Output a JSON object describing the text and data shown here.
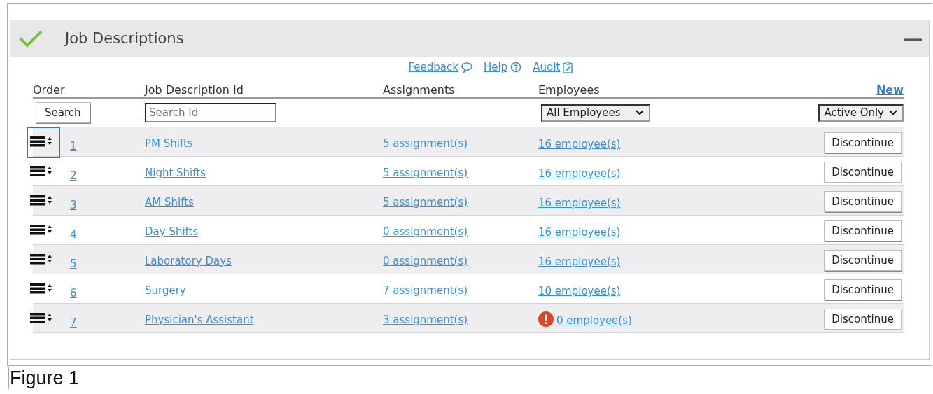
{
  "panel": {
    "title": "Job Descriptions",
    "collapse": "—"
  },
  "links": [
    {
      "label": "Feedback",
      "kind": "feedback"
    },
    {
      "label": "Help",
      "kind": "help"
    },
    {
      "label": "Audit",
      "kind": "audit"
    }
  ],
  "columns": [
    "Order",
    "Job Description Id",
    "Assignments",
    "Employees"
  ],
  "new_link": "New",
  "filters": {
    "search_button": "Search",
    "search_placeholder": "Search Id",
    "employees_select": "All Employees",
    "status_select": "Active Only"
  },
  "rows": [
    {
      "order": "1",
      "name": "PM Shifts",
      "assignments": "5 assignment(s)",
      "employees": "16 employee(s)",
      "warning": false,
      "focused": true,
      "action": "Discontinue"
    },
    {
      "order": "2",
      "name": "Night Shifts",
      "assignments": "5 assignment(s)",
      "employees": "16 employee(s)",
      "warning": false,
      "focused": false,
      "action": "Discontinue"
    },
    {
      "order": "3",
      "name": "AM Shifts",
      "assignments": "5 assignment(s)",
      "employees": "16 employee(s)",
      "warning": false,
      "focused": false,
      "action": "Discontinue"
    },
    {
      "order": "4",
      "name": "Day Shifts",
      "assignments": "0 assignment(s)",
      "employees": "16 employee(s)",
      "warning": false,
      "focused": false,
      "action": "Discontinue"
    },
    {
      "order": "5",
      "name": "Laboratory Days",
      "assignments": "0 assignment(s)",
      "employees": "16 employee(s)",
      "warning": false,
      "focused": false,
      "action": "Discontinue"
    },
    {
      "order": "6",
      "name": "Surgery",
      "assignments": "7 assignment(s)",
      "employees": "10 employee(s)",
      "warning": false,
      "focused": false,
      "action": "Discontinue"
    },
    {
      "order": "7",
      "name": "Physician's Assistant",
      "assignments": "3 assignment(s)",
      "employees": "0 employee(s)",
      "warning": true,
      "focused": false,
      "action": "Discontinue"
    }
  ],
  "caption": "Figure 1"
}
